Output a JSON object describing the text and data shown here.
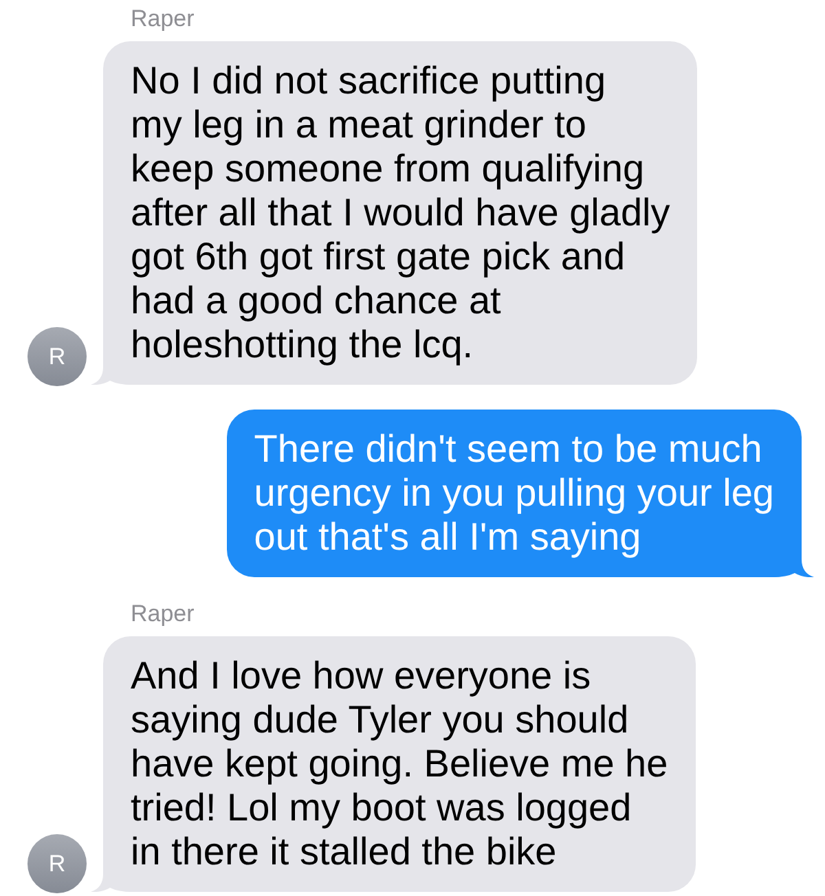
{
  "messages": [
    {
      "kind": "incoming",
      "sender": "Raper",
      "avatar": "R",
      "text": "No I did not sacrifice putting\nmy leg in a meat grinder to\nkeep someone from qualifying\nafter all that I would have gladly\ngot 6th got first gate pick and\nhad a good chance at\nholeshotting the lcq."
    },
    {
      "kind": "outgoing",
      "text": "There didn't seem to be much\nurgency in you pulling your leg\nout that's all I'm saying"
    },
    {
      "kind": "incoming",
      "sender": "Raper",
      "avatar": "R",
      "text": "And I love how everyone is\nsaying dude Tyler you should\nhave kept going. Believe me he\ntried! Lol my boot was logged\nin there it stalled the bike"
    }
  ]
}
